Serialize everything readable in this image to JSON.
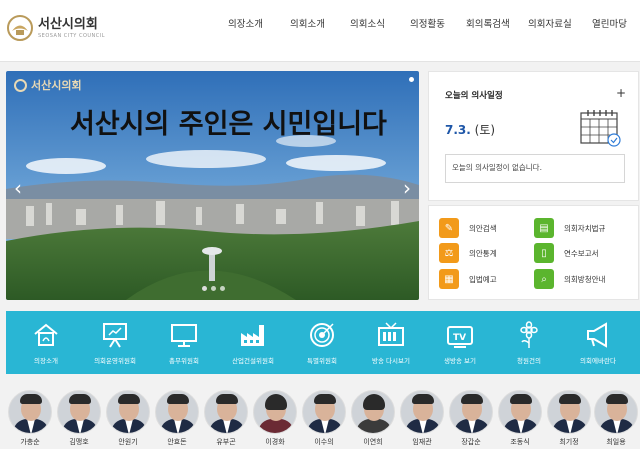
{
  "header": {
    "logo_text": "서산시의회",
    "logo_sub": "SEOSAN CITY COUNCIL",
    "nav": [
      "의장소개",
      "의회소개",
      "의회소식",
      "의정활동",
      "회의록검색",
      "의회자료실",
      "열린마당"
    ]
  },
  "slider": {
    "logo_text": "서산시의회",
    "slogan": "서산시의 주인은 시민입니다",
    "prev_icon": "chevron-left-icon",
    "next_icon": "chevron-right-icon"
  },
  "schedule": {
    "title": "오늘의 의사일정",
    "plus": "+",
    "date": "7.3.",
    "weekday": "(토)",
    "message": "오늘의 의사일정이 없습니다."
  },
  "quick_links": [
    {
      "label": "의안검색",
      "icon": "memo-icon",
      "color": "#f29a1a"
    },
    {
      "label": "의회자치법규",
      "icon": "book-icon",
      "color": "#5bb52e"
    },
    {
      "label": "의안통계",
      "icon": "gavel-icon",
      "color": "#f29a1a"
    },
    {
      "label": "연수보고서",
      "icon": "mobile-icon",
      "color": "#5bb52e"
    },
    {
      "label": "입법예고",
      "icon": "document-icon",
      "color": "#f29a1a"
    },
    {
      "label": "의회방청안내",
      "icon": "magnifier-icon",
      "color": "#5bb52e"
    }
  ],
  "band": [
    {
      "label": "의장소개",
      "icon": "house-icon"
    },
    {
      "label": "의회운영위원회",
      "icon": "presentation-icon"
    },
    {
      "label": "총무위원회",
      "icon": "monitor-icon"
    },
    {
      "label": "산업건설위원회",
      "icon": "factory-icon"
    },
    {
      "label": "특별위원회",
      "icon": "target-icon"
    },
    {
      "label": "방송 다시보기",
      "icon": "tv-icon"
    },
    {
      "label": "생방송 보기",
      "icon": "tv-play-icon"
    },
    {
      "label": "청원건의",
      "icon": "flower-icon"
    },
    {
      "label": "의회에바란다",
      "icon": "megaphone-icon"
    }
  ],
  "members": [
    "가충순",
    "김맹호",
    "안원기",
    "안효돈",
    "유부곤",
    "이경화",
    "이수의",
    "이연희",
    "임재관",
    "장갑순",
    "조동식",
    "최기정",
    "최일용"
  ],
  "colors": {
    "band": "#29b6d4",
    "accent_orange": "#f29a1a",
    "accent_green": "#5bb52e",
    "date_blue": "#1f57a8"
  }
}
